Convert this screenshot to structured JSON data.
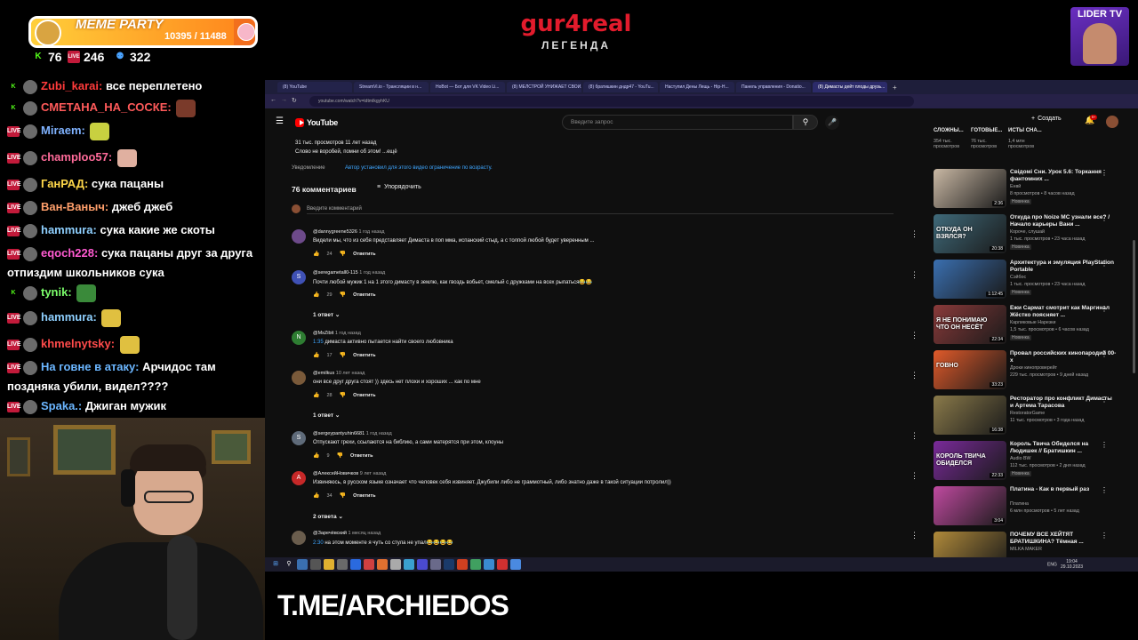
{
  "overlay": {
    "meme_title": "MEME PARTY",
    "meme_count": "10395 / 11488",
    "meme_progress": 0.9049,
    "stats": [
      {
        "icon": "kick-icon",
        "value": "76",
        "color": "#53fc18"
      },
      {
        "icon": "vk-live-icon",
        "value": "246",
        "color": "#c21a3a"
      },
      {
        "icon": "viewers-icon",
        "value": "322",
        "color": "#4aa3ff"
      }
    ],
    "brand_name": "gur4real",
    "brand_sub": "ЛЕГЕНДА",
    "lider_label": "LIDER TV"
  },
  "chat": [
    {
      "platform": "kick",
      "user": "Zubi_karai:",
      "user_color": "#ff3b3b",
      "text": "все переплетено"
    },
    {
      "platform": "kick",
      "user": "СМЕТАНА_НА_СОСКЕ:",
      "user_color": "#ff5a5a",
      "text": ""
    },
    {
      "platform": "live",
      "user": "Miraem:",
      "user_color": "#7fb2ff",
      "text": ""
    },
    {
      "platform": "live",
      "user": "champloo57:",
      "user_color": "#ff6b9a",
      "text": ""
    },
    {
      "platform": "live",
      "user": "ГанРАД:",
      "user_color": "#ffd84a",
      "text": "сука пацаны"
    },
    {
      "platform": "live",
      "user": "Ван-Ваныч:",
      "user_color": "#ff9f6b",
      "text": "джеб джеб"
    },
    {
      "platform": "live",
      "user": "hammura:",
      "user_color": "#8fd0ff",
      "text": "сука какие же скоты"
    },
    {
      "platform": "live",
      "user": "eqoch228:",
      "user_color": "#ff5ad1",
      "text": "сука пацаны друг за друга отпиздим школьников сука"
    },
    {
      "platform": "kick",
      "user": "tynik:",
      "user_color": "#7cff6b",
      "text": ""
    },
    {
      "platform": "live",
      "user": "hammura:",
      "user_color": "#8fd0ff",
      "text": ""
    },
    {
      "platform": "live",
      "user": "khmelnytsky:",
      "user_color": "#ff4b4b",
      "text": ""
    },
    {
      "platform": "live",
      "user": "На говне в атаку:",
      "user_color": "#6bb6ff",
      "text": "Арчидос там позднякa убили, видел????"
    },
    {
      "platform": "live",
      "user": "Spaka.:",
      "user_color": "#6bb6ff",
      "text": "Джиган мужик"
    }
  ],
  "browser": {
    "tabs": [
      "(8) YouTube",
      "StreamVi.io - Трансляции в н...",
      "HoBot — Бот для VK Video Li...",
      "(8) МЕЛСТРОЙ УНИЖАЕТ СВОИ...",
      "(8) братишкин дндр47 - YouTu...",
      "Наступил Дены Лещь - Hip-H...",
      "Панель управления - Donatio...",
      "(8) Димасты дейт плоды друзь..."
    ],
    "address": "youtube.com/watch?v=tdtmIkgyhKU",
    "search_placeholder": "Введите запрос",
    "create_label": "Создать",
    "bell_count": "9+"
  },
  "video": {
    "views_line": "31 тыс. просмотров  11 лет назад",
    "description": "Слово не воробей, помни об этом! ...ещё",
    "notice_label": "Уведомление",
    "notice_text": "Автор установил для этого видео ограничение по возрасту.",
    "comments_count": "76 комментариев",
    "sort_label": "Упорядочить",
    "add_comment_placeholder": "Введите комментарий"
  },
  "comments": [
    {
      "author": "@dannygreene5326",
      "time": "1 год назад",
      "text": "Видели мы, что из себя представляет Димаста в поп мма, испанский стыд, а с толпой любой будет уверенным ...",
      "likes": "24",
      "reply_label": "Ответить",
      "avatar_color": "#6d4a8a",
      "avatar": "",
      "replies": ""
    },
    {
      "author": "@seregametall0-115",
      "time": "1 год назад",
      "text": "Почти любой мужик 1 на 1 этого димасту в землю, как гвоздь вобьет, смелый с дружками на всех рыпаться😂😂",
      "likes": "29",
      "reply_label": "Ответить",
      "avatar_color": "#3f51b5",
      "avatar": "S",
      "replies": "1 ответ"
    },
    {
      "author": "@MsZibit",
      "time": "1 год назад",
      "ts": "1:35",
      "text": " димаста активно пытается найти своего любовника",
      "likes": "17",
      "reply_label": "Ответить",
      "avatar_color": "#2e7d32",
      "avatar": "N",
      "replies": ""
    },
    {
      "author": "@emilkus",
      "time": "10 лет назад",
      "text": "они все друг друга стоят )) здесь нет  плохи и хороших  ... как по мне",
      "likes": "28",
      "reply_label": "Ответить",
      "avatar_color": "#7a5a3a",
      "avatar": "",
      "replies": "1 ответ"
    },
    {
      "author": "@sergeypantyuhin6681",
      "time": "1 год назад",
      "text": "Отпускают грехи, ссылаются на библию, а сами матерятся при этом, клоуны",
      "likes": "9",
      "reply_label": "Ответить",
      "avatar_color": "#5f6b7a",
      "avatar": "S",
      "replies": ""
    },
    {
      "author": "@АлексейНовичков",
      "time": "9 лет назад",
      "text": "Извиняюсь, в русском языке означает что человек себя извиняет. Джубили либо не граммотный, либо знатно даже в такой ситуации потролил))",
      "likes": "34",
      "reply_label": "Ответить",
      "avatar_color": "#c62828",
      "avatar": "А",
      "replies": "2 ответа"
    },
    {
      "author": "@Заречёвский",
      "time": "1 месяц назад",
      "ts": "2:30",
      "text": " на этом моменте я чуть со стула не упал😂😂😂😂",
      "likes": "",
      "reply_label": "",
      "avatar_color": "#6a5d4d",
      "avatar": "",
      "replies": ""
    }
  ],
  "recommendations_top": [
    {
      "title": "СЛОЖНЫ...",
      "meta": "354 тыс. просмотров"
    },
    {
      "title": "ГОТОВЫЕ...",
      "meta": "76 тыс. просмотров"
    },
    {
      "title": "ИСТЫ СНА...",
      "meta": "1,4 млн просмотров"
    }
  ],
  "recommendations": [
    {
      "title": "Свідомі Сни. Урок 5.6: Торкання фантомних ...",
      "channel": "Енвй",
      "meta": "8 просмотров • 8 часов назад",
      "badge": "Новинка",
      "duration": "2:36",
      "thumb": "#c9b8a4"
    },
    {
      "title": "Откуда про Noize MC узнали все? / Начало карьеры Вани ...",
      "channel": "Короче, слушай",
      "meta": "1 тыс. просмотров • 23 часа назад",
      "badge": "Новинка",
      "duration": "20:38",
      "thumb": "#3f6a7a",
      "thumb_text": "ОТКУДА ОН ВЗЯЛСЯ?"
    },
    {
      "title": "Архитектура и эмуляция PlayStation Portable",
      "channel": "Сэйбос",
      "meta": "1 тыс. просмотров • 23 часа назад",
      "badge": "Новинка",
      "duration": "1:12:45",
      "thumb": "#3a6fb0"
    },
    {
      "title": "Ежи Сармат смотрит как Маргинал Жёстко поясняет ...",
      "channel": "Карликовые Нарезки",
      "meta": "1,5 тыс. просмотров • 6 часов назад",
      "badge": "Новинка",
      "duration": "22:34",
      "thumb": "#8a3a3a",
      "thumb_text": "Я НЕ ПОНИМАЮ ЧТО ОН НЕСЁТ"
    },
    {
      "title": "Провал российских кинопародий 00-х",
      "channel": "Дроки кинопроверейт",
      "meta": "229 тыс. просмотров • 9 дней назад",
      "badge": "",
      "duration": "33:23",
      "thumb": "#e05a2a",
      "thumb_text": "ГОВНО"
    },
    {
      "title": "Ресторатор про конфликт Димасты и Артема Тарасова",
      "channel": "RestoratorGame",
      "meta": "11 тыс. просмотров • 3 года назад",
      "badge": "",
      "duration": "16:38",
      "thumb": "#8a7a4a"
    },
    {
      "title": "Король Твича Обиделся на Людишек // Братишкин ...",
      "channel": "Audio BW",
      "meta": "112 тыс. просмотров • 2 дня назад",
      "badge": "Новинка",
      "duration": "22:33",
      "thumb": "#7a2a9a",
      "thumb_text": "КОРОЛЬ ТВИЧА ОБИДЕЛСЯ"
    },
    {
      "title": "Платина - Как в первый раз",
      "channel": "Платина",
      "meta": "6 млн просмотров • 5 лет назад",
      "badge": "",
      "duration": "3:04",
      "thumb": "#c04aa0"
    },
    {
      "title": "ПОЧЕМУ ВСЕ ХЕЙТЯТ БРАТИШКИНА? Тёмная ...",
      "channel": "MILKA MAKER",
      "meta": "",
      "badge": "",
      "duration": "",
      "thumb": "#b08a3a"
    }
  ],
  "taskbar": {
    "lang": "ENG",
    "time": "19:04",
    "date": "29.10.2023"
  },
  "banner_text": "T.ME/ARCHIEDOS"
}
